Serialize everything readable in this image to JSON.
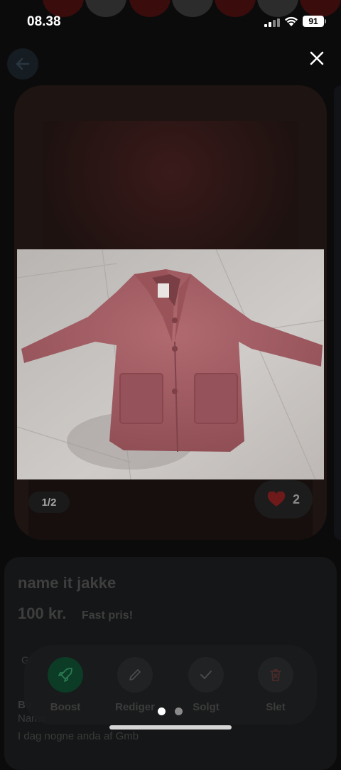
{
  "status_bar": {
    "time": "08.38",
    "battery": "91"
  },
  "listing": {
    "title": "name it jakke",
    "price": "100 kr.",
    "price_note": "Fast pris!",
    "section_label_partial": "Gr",
    "subheading_partial": "Bu",
    "description_line1": "Name",
    "description_line2": "I dag nogne anda af Gmb"
  },
  "gallery": {
    "counter": "1/2",
    "likes": "2",
    "page_index": 0,
    "page_count": 2
  },
  "actions": [
    {
      "label": "Boost",
      "icon": "rocket-icon"
    },
    {
      "label": "Rediger",
      "icon": "pencil-icon"
    },
    {
      "label": "Solgt",
      "icon": "check-icon"
    },
    {
      "label": "Slet",
      "icon": "trash-icon"
    }
  ],
  "colors": {
    "coat": "#a05a60",
    "floor": "#c8c4c1",
    "boost_green": "#0c3b26",
    "heart": "#7a1d1d"
  }
}
